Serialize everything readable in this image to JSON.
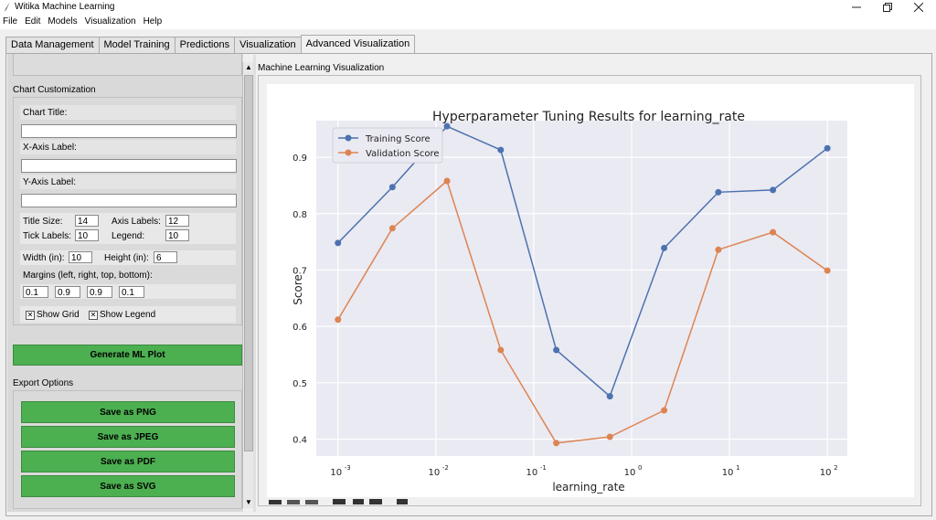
{
  "window": {
    "title": "Witika Machine Learning"
  },
  "menu": [
    "File",
    "Edit",
    "Models",
    "Visualization",
    "Help"
  ],
  "tabs": [
    "Data Management",
    "Model Training",
    "Predictions",
    "Visualization",
    "Advanced Visualization"
  ],
  "active_tab": 4,
  "left": {
    "chart_customization": "Chart Customization",
    "chart_title_label": "Chart Title:",
    "chart_title_value": "",
    "xaxis_label": "X-Axis Label:",
    "xaxis_value": "",
    "yaxis_label": "Y-Axis Label:",
    "yaxis_value": "",
    "title_size_label": "Title Size:",
    "title_size": "14",
    "axis_labels_label": "Axis Labels:",
    "axis_labels": "12",
    "tick_labels_label": "Tick Labels:",
    "tick_labels": "10",
    "legend_label": "Legend:",
    "legend": "10",
    "width_label": "Width (in):",
    "width": "10",
    "height_label": "Height (in):",
    "height": "6",
    "margins_label": "Margins (left, right, top, bottom):",
    "margins": [
      "0.1",
      "0.9",
      "0.9",
      "0.1"
    ],
    "show_grid": "Show Grid",
    "show_legend": "Show Legend",
    "generate": "Generate ML Plot",
    "export_options": "Export Options",
    "save_png": "Save as PNG",
    "save_jpeg": "Save as JPEG",
    "save_pdf": "Save as PDF",
    "save_svg": "Save as SVG"
  },
  "right": {
    "frame_label": "Machine Learning Visualization"
  },
  "colors": {
    "green": "#4caf50",
    "axes_bg": "#eaeaf2",
    "train": "#4c72b0",
    "val": "#dd8452"
  },
  "chart_data": {
    "type": "line",
    "title": "Hyperparameter Tuning Results for learning_rate",
    "xlabel": "learning_rate",
    "ylabel": "Score",
    "xscale": "log",
    "xlim": [
      0.0006,
      160
    ],
    "ylim": [
      0.37,
      0.965
    ],
    "xticks": [
      0.001,
      0.01,
      0.1,
      1,
      10,
      100
    ],
    "xtick_exponents": [
      "-3",
      "-2",
      "-1",
      "0",
      "1",
      "2"
    ],
    "yticks": [
      0.4,
      0.5,
      0.6,
      0.7,
      0.8,
      0.9
    ],
    "ytick_labels": [
      "0.4",
      "0.5",
      "0.6",
      "0.7",
      "0.8",
      "0.9"
    ],
    "grid": true,
    "legend": "top-left",
    "x": [
      0.001,
      0.0036,
      0.013,
      0.046,
      0.17,
      0.6,
      2.15,
      7.7,
      27.8,
      100
    ],
    "series": [
      {
        "name": "Training Score",
        "values": [
          0.748,
          0.847,
          0.955,
          0.913,
          0.558,
          0.476,
          0.739,
          0.838,
          0.842,
          0.916
        ]
      },
      {
        "name": "Validation Score",
        "values": [
          0.612,
          0.774,
          0.858,
          0.558,
          0.393,
          0.404,
          0.451,
          0.736,
          0.767,
          0.699
        ]
      }
    ]
  }
}
